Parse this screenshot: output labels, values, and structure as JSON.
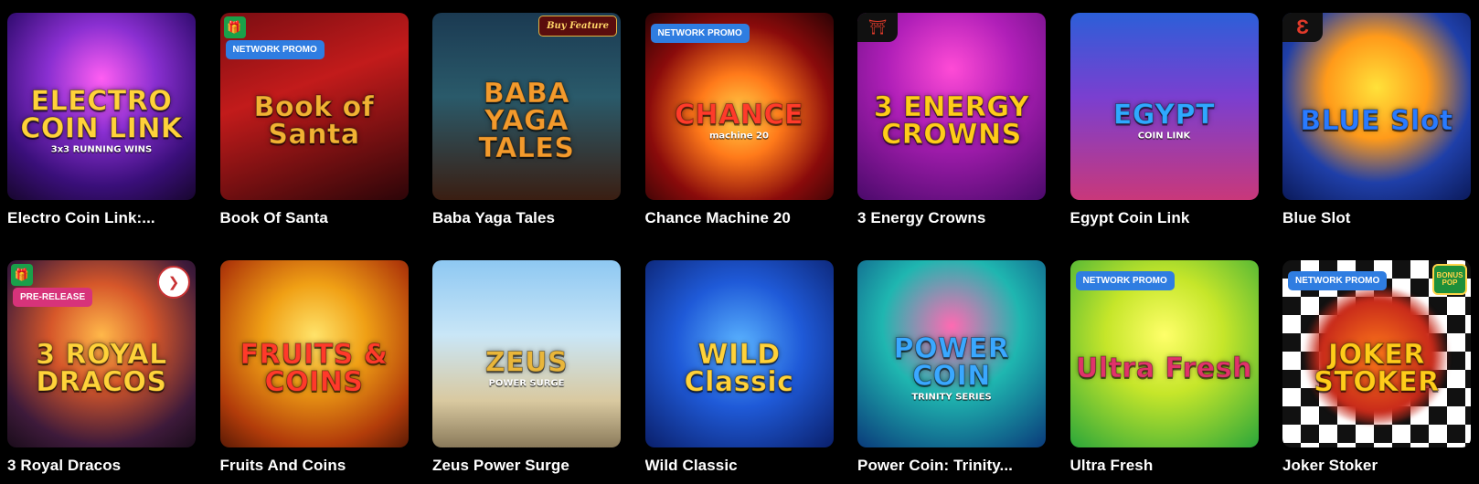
{
  "games": [
    {
      "title": "Electro Coin Link:...",
      "logo": "ELECTRO COIN LINK",
      "sub": "3x3 RUNNING WINS",
      "bg": "radial-gradient(circle at 50% 35%, #ff5ef2 0%, #8a2fd1 35%, #3a0f7a 70%, #17062d 100%)",
      "logo_color": "#ffd23a"
    },
    {
      "title": "Book Of Santa",
      "logo": "Book of Santa",
      "badge": "NETWORK PROMO",
      "tag": "gift",
      "bg": "linear-gradient(160deg, #7a0d12 0%, #c21b1b 40%, #2c0508 100%)",
      "logo_color": "#f2b233"
    },
    {
      "title": "Baba Yaga Tales",
      "logo": "BABA YAGA TALES",
      "badge_buy": "Buy Feature",
      "bg": "linear-gradient(180deg, #1b3a52 0%, #2a5a6a 45%, #3a1e12 100%)",
      "logo_color": "#f39a2c"
    },
    {
      "title": "Chance Machine 20",
      "logo": "CHANCE",
      "sub": "machine 20",
      "badge": "NETWORK PROMO",
      "bg": "radial-gradient(circle at 50% 55%, #ffd24a 0%, #ff7a1a 30%, #8a0b0b 65%, #2a0304 100%)",
      "logo_color": "#ff3b2a"
    },
    {
      "title": "3 Energy Crowns",
      "logo": "3 ENERGY CROWNS",
      "tag": "pagoda",
      "bg": "radial-gradient(circle at 50% 30%, #ff4bd6 0%, #b01fb8 40%, #4a0a6a 100%)",
      "logo_color": "#ffcc1a"
    },
    {
      "title": "Egypt Coin Link",
      "logo": "EGYPT",
      "sub": "COIN LINK",
      "bg": "linear-gradient(180deg, #2c5fd8 0%, #7a3fd0 45%, #c9387a 100%)",
      "logo_color": "#2fa8ff"
    },
    {
      "title": "Blue Slot",
      "logo": "BLUE Slot",
      "tag": "endorphina",
      "bg": "radial-gradient(circle at 50% 40%, #ffe23a 0%, #ff9a1a 35%, #1f3fa8 65%, #0b1a5a 100%)",
      "logo_color": "#2a7bff"
    },
    {
      "title": "3 Royal Dracos",
      "logo": "3 ROYAL DRACOS",
      "badge_pr": "PRE-RELEASE",
      "tag": "gift",
      "corner": true,
      "bg": "radial-gradient(circle at 50% 40%, #ffb84a 0%, #d6572a 35%, #3d1a3a 75%, #1a0c1a 100%)",
      "logo_color": "#ffd23a"
    },
    {
      "title": "Fruits And Coins",
      "logo": "FRUITS & COINS",
      "bg": "radial-gradient(circle at 50% 40%, #ffe36a 0%, #f0a015 35%, #b23c0a 75%, #5a1a05 100%)",
      "logo_color": "#ff3a2a"
    },
    {
      "title": "Zeus Power Surge",
      "logo": "ZEUS",
      "sub": "POWER SURGE",
      "bg": "linear-gradient(180deg, #8ec8f2 0%, #c9e6f7 40%, #d9c9a0 75%, #8a7a5a 100%)",
      "logo_color": "#e9b63a"
    },
    {
      "title": "Wild Classic",
      "logo": "WILD Classic",
      "bg": "radial-gradient(circle at 50% 45%, #5ab3ff 0%, #1f5ad8 45%, #0a1f6a 100%)",
      "logo_color": "#ffd23a"
    },
    {
      "title": "Power Coin: Trinity...",
      "logo": "POWER COIN",
      "sub": "TRINITY SERIES",
      "bg": "radial-gradient(circle at 50% 35%, #ff6ab2 0%, #1fb6b0 45%, #0a3a7a 100%)",
      "logo_color": "#3aa8ff"
    },
    {
      "title": "Ultra Fresh",
      "logo": "Ultra Fresh",
      "badge": "NETWORK PROMO",
      "bg": "radial-gradient(circle at 50% 40%, #ffff6a 0%, #c6e62a 40%, #2aa63a 100%)",
      "logo_color": "#e0336a"
    },
    {
      "title": "Joker Stoker",
      "logo": "JOKER STOKER",
      "badge": "NETWORK PROMO",
      "bonus": "BONUS POP",
      "bg": "repeating-conic-gradient(#ffffff 0% 25%, #111111 0% 50%) 0 0 / 40px 40px",
      "logo_color": "#ffcc1a"
    }
  ],
  "colors": {
    "np_badge": "#2f7de1",
    "pr_badge": "#d7337a",
    "page_bg": "#000000"
  }
}
